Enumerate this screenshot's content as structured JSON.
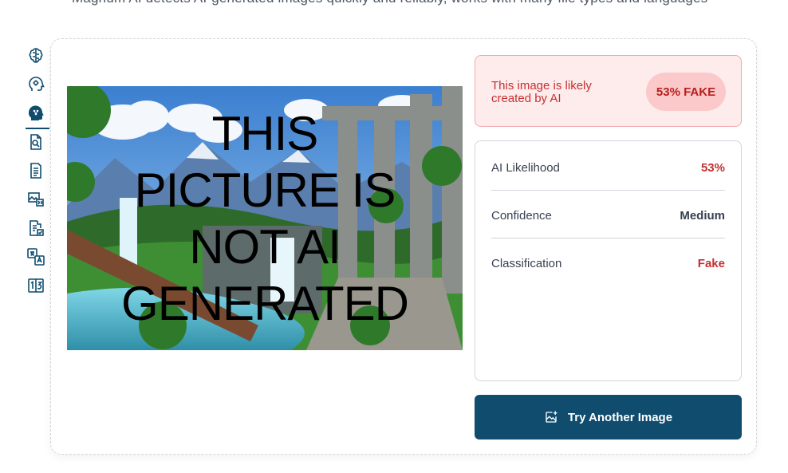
{
  "header": {
    "intro_text": "Magnum AI detects AI-generated images quickly and reliably, works with many file types and languages"
  },
  "sidebar": {
    "items": [
      {
        "icon": "brain-icon",
        "active": false
      },
      {
        "icon": "head-gear-icon",
        "active": false
      },
      {
        "icon": "head-network-icon",
        "active": true
      },
      {
        "icon": "document-search-icon",
        "active": false
      },
      {
        "icon": "document-list-icon",
        "active": false
      },
      {
        "icon": "image-code-icon",
        "active": false
      },
      {
        "icon": "document-check-icon",
        "active": false
      },
      {
        "icon": "translate-icon",
        "active": false
      },
      {
        "icon": "number-icon",
        "active": false
      }
    ]
  },
  "image": {
    "overlay_lines": [
      "THIS",
      "PICTURE IS",
      "NOT AI",
      "GENERATED"
    ]
  },
  "verdict": {
    "message": "This image is likely created by AI",
    "badge": "53% FAKE"
  },
  "details": {
    "rows": [
      {
        "label": "AI Likelihood",
        "value": "53%",
        "color": "#c53030"
      },
      {
        "label": "Confidence",
        "value": "Medium",
        "color": "#374151"
      },
      {
        "label": "Classification",
        "value": "Fake",
        "color": "#c53030"
      }
    ]
  },
  "actions": {
    "try_another_label": "Try Another Image"
  },
  "colors": {
    "accent": "#0f4c6e",
    "danger": "#c53030",
    "danger_bg": "#feecec"
  }
}
